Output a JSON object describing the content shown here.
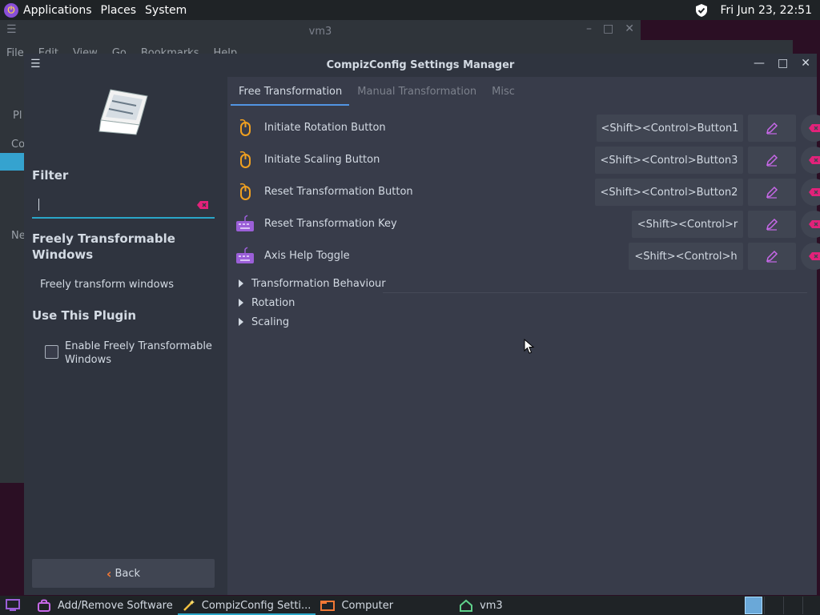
{
  "top_panel": {
    "menus": [
      "Applications",
      "Places",
      "System"
    ],
    "clock": "Fri Jun 23, 22:51"
  },
  "bg_window": {
    "title": "vm3",
    "menus": [
      "File",
      "Edit",
      "View",
      "Go",
      "Bookmarks",
      "Help"
    ],
    "side_fragments": [
      "Pl",
      "Co",
      "Ne"
    ]
  },
  "window": {
    "title": "CompizConfig Settings Manager"
  },
  "left": {
    "filter_heading": "Filter",
    "filter_value": "",
    "plugin_name": "Freely Transformable Windows",
    "plugin_description": "Freely transform windows",
    "use_heading": "Use This Plugin",
    "enable_label": "Enable Freely Transformable Windows",
    "enable_checked": false,
    "back_label": "Back"
  },
  "tabs": [
    "Free Transformation",
    "Manual Transformation",
    "Misc"
  ],
  "active_tab": "Free Transformation",
  "settings": [
    {
      "label": "Initiate Rotation Button",
      "binding": "<Shift><Control>Button1",
      "icon": "mouse-icon"
    },
    {
      "label": "Initiate Scaling Button",
      "binding": "<Shift><Control>Button3",
      "icon": "mouse-icon"
    },
    {
      "label": "Reset Transformation Button",
      "binding": "<Shift><Control>Button2",
      "icon": "mouse-icon"
    },
    {
      "label": "Reset Transformation Key",
      "binding": "<Shift><Control>r",
      "icon": "keyboard-icon"
    },
    {
      "label": "Axis Help Toggle",
      "binding": "<Shift><Control>h",
      "icon": "keyboard-icon"
    }
  ],
  "groups": [
    "Transformation Behaviour",
    "Rotation",
    "Scaling"
  ],
  "taskbar": {
    "tasks": [
      {
        "label": "Add/Remove Software",
        "icon": "software-icon"
      },
      {
        "label": "CompizConfig Setti...",
        "icon": "ccsm-icon",
        "active": true
      },
      {
        "label": "Computer",
        "icon": "folder-icon"
      },
      {
        "label": "vm3",
        "icon": "home-icon"
      }
    ]
  },
  "colors": {
    "accent": "#2aa6c8",
    "tab_underline": "#5294e2",
    "clear_red": "#e2227a",
    "edit_purple": "#c768e8",
    "mouse_orange": "#f0a020",
    "keyboard_purple": "#9b5fd8"
  }
}
